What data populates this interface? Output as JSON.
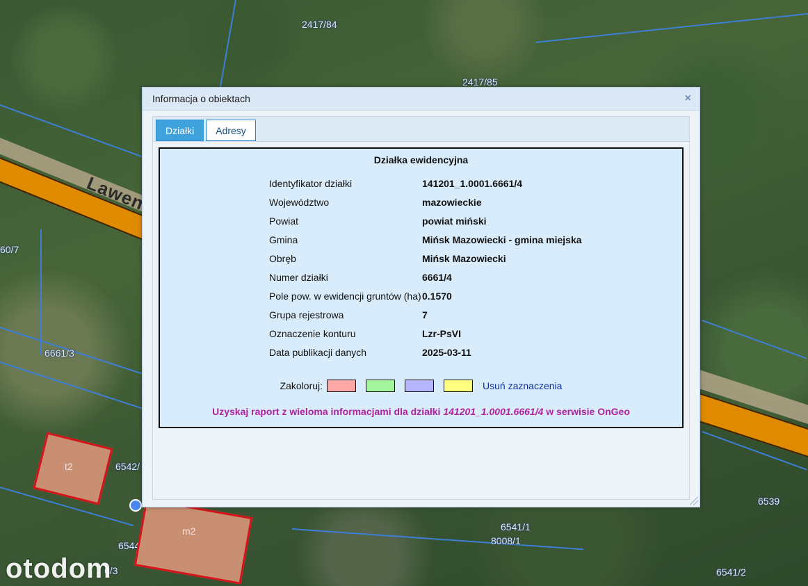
{
  "map": {
    "street_label": "Lawen",
    "parcel_labels": [
      "2417/84",
      "2417/85",
      "60/7",
      "6661/3",
      "6542/",
      "6544/5",
      "6541/1",
      "8008/1",
      "6539",
      "6541/2",
      "6/3"
    ],
    "building_labels": [
      "t2",
      "m2"
    ],
    "watermark": "otodom"
  },
  "dialog": {
    "title": "Informacja o obiektach",
    "close_symbol": "×",
    "tabs": [
      {
        "label": "Działki",
        "active": true
      },
      {
        "label": "Adresy",
        "active": false
      }
    ],
    "card": {
      "heading": "Działka ewidencyjna",
      "rows": [
        {
          "label": "Identyfikator działki",
          "value": "141201_1.0001.6661/4"
        },
        {
          "label": "Województwo",
          "value": "mazowieckie"
        },
        {
          "label": "Powiat",
          "value": "powiat miński"
        },
        {
          "label": "Gmina",
          "value": "Mińsk Mazowiecki - gmina miejska"
        },
        {
          "label": "Obręb",
          "value": "Mińsk Mazowiecki"
        },
        {
          "label": "Numer działki",
          "value": "6661/4"
        },
        {
          "label": "Pole pow. w ewidencji gruntów (ha)",
          "value": "0.1570"
        },
        {
          "label": "Grupa rejestrowa",
          "value": "7"
        },
        {
          "label": "Oznaczenie konturu",
          "value": "Lzr-PsVI"
        },
        {
          "label": "Data publikacji danych",
          "value": "2025-03-11"
        }
      ],
      "colorize_label": "Zakoloruj:",
      "swatches": [
        "#ffa8a8",
        "#a4f59e",
        "#b4b4ff",
        "#ffff80"
      ],
      "remove_link": "Usuń zaznaczenia",
      "report_prefix": "Uzyskaj raport z wieloma informacjami dla działki ",
      "report_parcel": "141201_1.0001.6661/4",
      "report_suffix": " w serwisie OnGeo"
    }
  }
}
